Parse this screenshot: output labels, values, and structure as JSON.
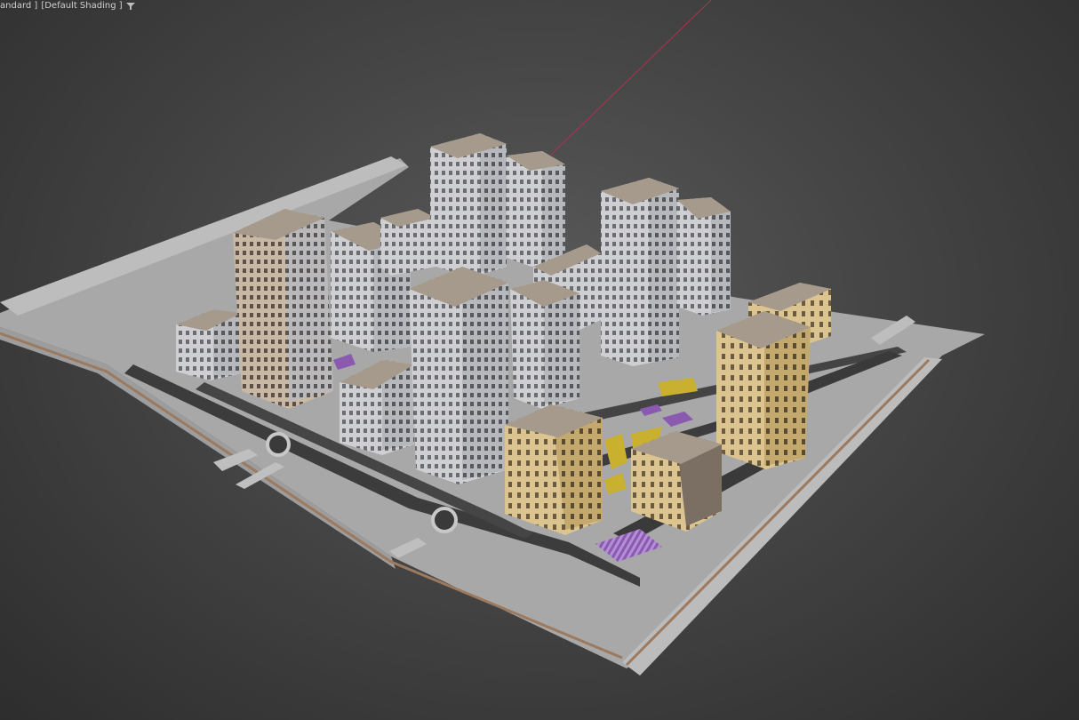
{
  "viewport": {
    "label_segments": [
      "andard ]",
      "[Default Shading ]"
    ],
    "filter_icon": "filter-icon",
    "background_color": "#454545"
  },
  "scene": {
    "description_type": "architectural massing model",
    "building_colors": {
      "grey_facade": "#cfcfd2",
      "tan_facade": "#d9c08a",
      "roof": "#a59a8c",
      "ground": "#a8a8a8",
      "road": "#3c3c3c",
      "path": "#c8c8c8",
      "accent_purple": "#8a5ab0",
      "accent_yellow": "#c9b02e",
      "axis_line": "#b03050"
    }
  }
}
